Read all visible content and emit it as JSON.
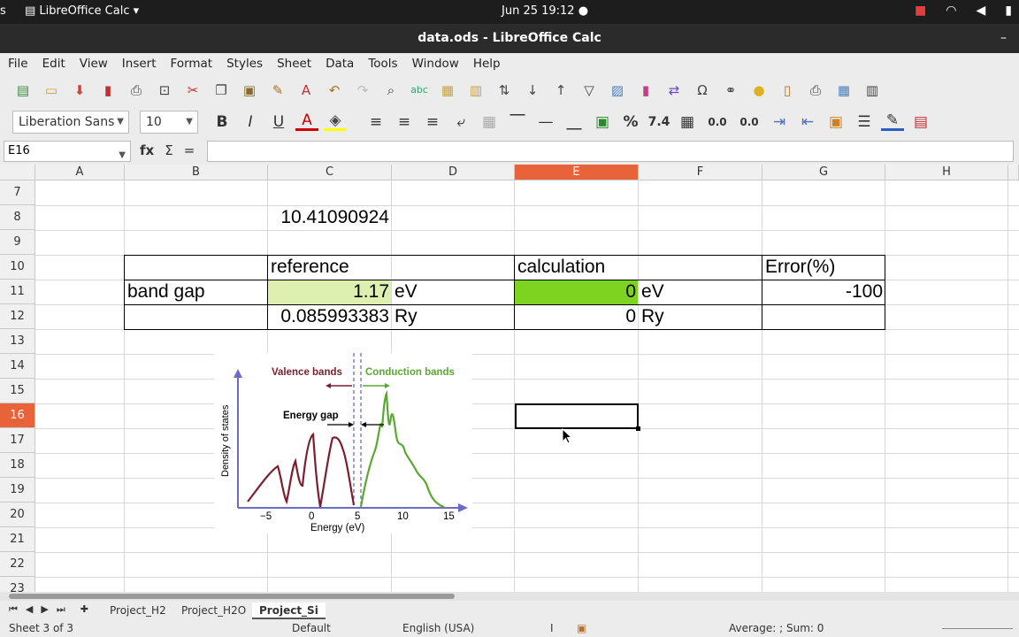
{
  "system_bar": {
    "left_label": "s",
    "app_name": "LibreOffice Calc",
    "datetime": "Jun 25  19:12"
  },
  "window": {
    "title": "data.ods - LibreOffice Calc",
    "minimize": "–"
  },
  "menu": [
    "File",
    "Edit",
    "View",
    "Insert",
    "Format",
    "Styles",
    "Sheet",
    "Data",
    "Tools",
    "Window",
    "Help"
  ],
  "format_toolbar": {
    "font_name": "Liberation Sans",
    "font_size": "10",
    "percent": "%",
    "number_fmt": "7.4",
    "add_decimal": "0.0",
    "del_decimal": "0.0"
  },
  "formula_bar": {
    "cell_ref": "E16",
    "fx": "fx",
    "sigma": "Σ",
    "equals": "=",
    "content": ""
  },
  "columns": [
    "A",
    "B",
    "C",
    "D",
    "E",
    "F",
    "G",
    "H"
  ],
  "selected_column": "E",
  "rows": [
    "7",
    "8",
    "9",
    "10",
    "11",
    "12",
    "13",
    "14",
    "15",
    "16",
    "17",
    "18",
    "19",
    "20",
    "21",
    "22",
    "23"
  ],
  "selected_row": "16",
  "cells": {
    "C8": "10.41090924",
    "C10": "reference",
    "E10": "calculation",
    "G10": "Error(%)",
    "B11": "band gap",
    "C11": "1.17",
    "D11": "eV",
    "E11": "0",
    "F11": "eV",
    "G11": "-100",
    "C12": "0.085993383",
    "D12": "Ry",
    "E12": "0",
    "F12": "Ry"
  },
  "colors": {
    "selection_header": "#e8623a",
    "reference_fill": "#ddf0b0",
    "calc_fill": "#7ed321",
    "valence": "#7b1f2e",
    "conduction": "#5aa832",
    "axis": "#6b6bc8"
  },
  "embedded_image": {
    "valence_label": "Valence bands",
    "conduction_label": "Conduction bands",
    "gap_label": "Energy gap",
    "y_label": "Density of states",
    "x_label": "Energy (eV)",
    "x_ticks": [
      "−5",
      "0",
      "5",
      "10",
      "15"
    ]
  },
  "sheet_tabs": [
    "Project_H2",
    "Project_H2O",
    "Project_Si"
  ],
  "active_tab": "Project_Si",
  "status": {
    "sheet_info": "Sheet 3 of 3",
    "page_style": "Default",
    "language": "English (USA)",
    "summary": "Average: ; Sum: 0"
  }
}
